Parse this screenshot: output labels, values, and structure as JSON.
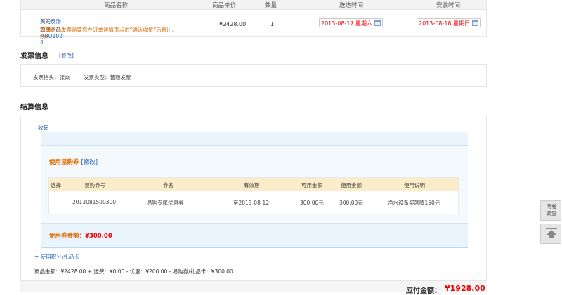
{
  "product_table": {
    "headers": [
      "商品名称",
      "商品单价",
      "数量",
      "送达时间",
      "安装时间"
    ],
    "row": {
      "name": "美的反渗透净水器MRO102-4",
      "vendor_tag": "（厂家配送）",
      "note": "厂送商品发票需要您在订单详情页点击“确认收货”后寄出。",
      "price": "¥2428.00",
      "qty": "1",
      "delivery_date": "2013-08-17 星期六",
      "install_date": "2013-08-18 星期日"
    }
  },
  "invoice": {
    "title": "发票信息",
    "edit": "[修改]",
    "header_label": "发票抬头：张焱",
    "type_label": "发票类型：普通发票"
  },
  "settlement": {
    "title": "结算信息",
    "collapse": "- 收起",
    "coupon_title": "使用易购券",
    "coupon_edit": "[修改]",
    "coupon_headers": [
      "选择",
      "易购券号",
      "券名",
      "有效期",
      "可用金额",
      "使用金额",
      "使用说明"
    ],
    "coupon_row": [
      "2013081500300",
      "易购专属优惠券",
      "至2013-08-12",
      "300.00元",
      "300.00元",
      "净水设备买就降150元"
    ],
    "coupon_total_label": "使用券金额：",
    "coupon_total_amount": "¥300.00",
    "points_link": "+ 使用积分/礼品卡",
    "summary": "商品金额：¥2428.00 + 运费：¥0.00 - 优惠：¥200.00 - 易购券/礼品卡：¥300.00"
  },
  "payable": {
    "label": "应付金额：",
    "amount": "¥1928.00"
  },
  "side": {
    "survey": "问卷调查"
  },
  "colors": {
    "link": "#1f5fb0",
    "orange": "#e06a00",
    "red": "#e00000",
    "panel_bg": "#eaf4fc",
    "coupon_head_bg": "#fbedc9"
  }
}
